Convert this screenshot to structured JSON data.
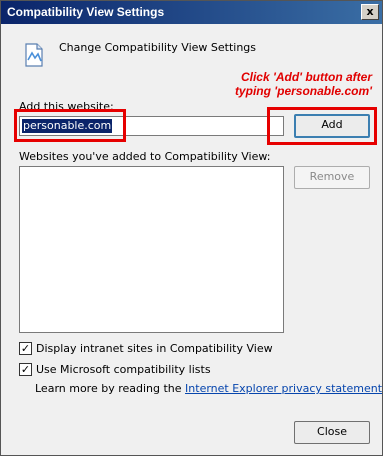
{
  "window": {
    "title": "Compatibility View Settings",
    "close_glyph": "x"
  },
  "header": {
    "icon": "page-icon",
    "text": "Change Compatibility View Settings"
  },
  "annotation": {
    "line1": "Click 'Add' button after",
    "line2": "typing 'personable.com'",
    "color": "#e10000"
  },
  "add_section": {
    "label": "Add this website:",
    "input_value": "personable.com",
    "add_button": "Add"
  },
  "list_section": {
    "label": "Websites you've added to Compatibility View:",
    "items": [],
    "remove_button": "Remove"
  },
  "options": {
    "intranet": {
      "label": "Display intranet sites in Compatibility View",
      "checked": true
    },
    "ms_lists": {
      "label": "Use Microsoft compatibility lists",
      "checked": true
    }
  },
  "learn_more": {
    "prefix": "Learn more by reading the ",
    "link": "Internet Explorer privacy statement"
  },
  "footer": {
    "close_button": "Close"
  }
}
